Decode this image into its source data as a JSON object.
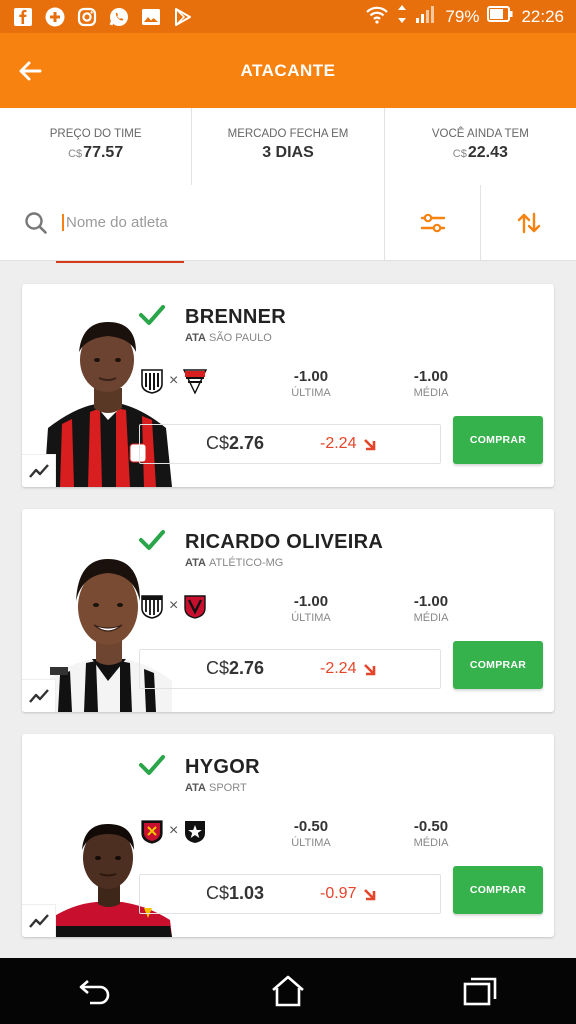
{
  "status_bar": {
    "battery": "79%",
    "time": "22:26",
    "left_icons": [
      "facebook-icon",
      "plus-icon",
      "instagram-icon",
      "whatsapp-icon",
      "gallery-icon",
      "play-store-icon"
    ],
    "right_icons": [
      "wifi-icon",
      "signal-icon",
      "battery-icon"
    ]
  },
  "header": {
    "title": "ATACANTE"
  },
  "stats": [
    {
      "label": "PREÇO DO TIME",
      "currency": "C$",
      "value": "77.57"
    },
    {
      "label": "MERCADO FECHA EM",
      "currency": "",
      "value": "3 DIAS"
    },
    {
      "label": "VOCÊ AINDA TEM",
      "currency": "C$",
      "value": "22.43"
    }
  ],
  "search": {
    "placeholder": "Nome do atleta",
    "value": ""
  },
  "labels": {
    "last": "ÚLTIMA",
    "avg": "MÉDIA",
    "buy": "COMPRAR",
    "vs": "×",
    "currency": "C$"
  },
  "players": [
    {
      "name": "BRENNER",
      "position": "ATA",
      "team": "SÃO PAULO",
      "last": "-1.00",
      "avg": "-1.00",
      "price": "2.76",
      "delta": "-2.24",
      "home_crest": "ceara-crest",
      "away_crest": "sao-paulo-crest",
      "shirt_colors": [
        "#111111",
        "#d81e1e",
        "#ffffff"
      ]
    },
    {
      "name": "RICARDO OLIVEIRA",
      "position": "ATA",
      "team": "ATLÉTICO-MG",
      "last": "-1.00",
      "avg": "-1.00",
      "price": "2.76",
      "delta": "-2.24",
      "home_crest": "atletico-mg-crest",
      "away_crest": "vitoria-crest",
      "shirt_colors": [
        "#111111",
        "#ffffff"
      ]
    },
    {
      "name": "HYGOR",
      "position": "ATA",
      "team": "SPORT",
      "last": "-0.50",
      "avg": "-0.50",
      "price": "1.03",
      "delta": "-0.97",
      "home_crest": "sport-crest",
      "away_crest": "botafogo-crest",
      "shirt_colors": [
        "#c8102e",
        "#111111"
      ]
    }
  ],
  "colors": {
    "primary": "#f7820f",
    "status_bar": "#e8700c",
    "buy": "#35b24c",
    "negative": "#e5452a",
    "check": "#2aa54a"
  }
}
